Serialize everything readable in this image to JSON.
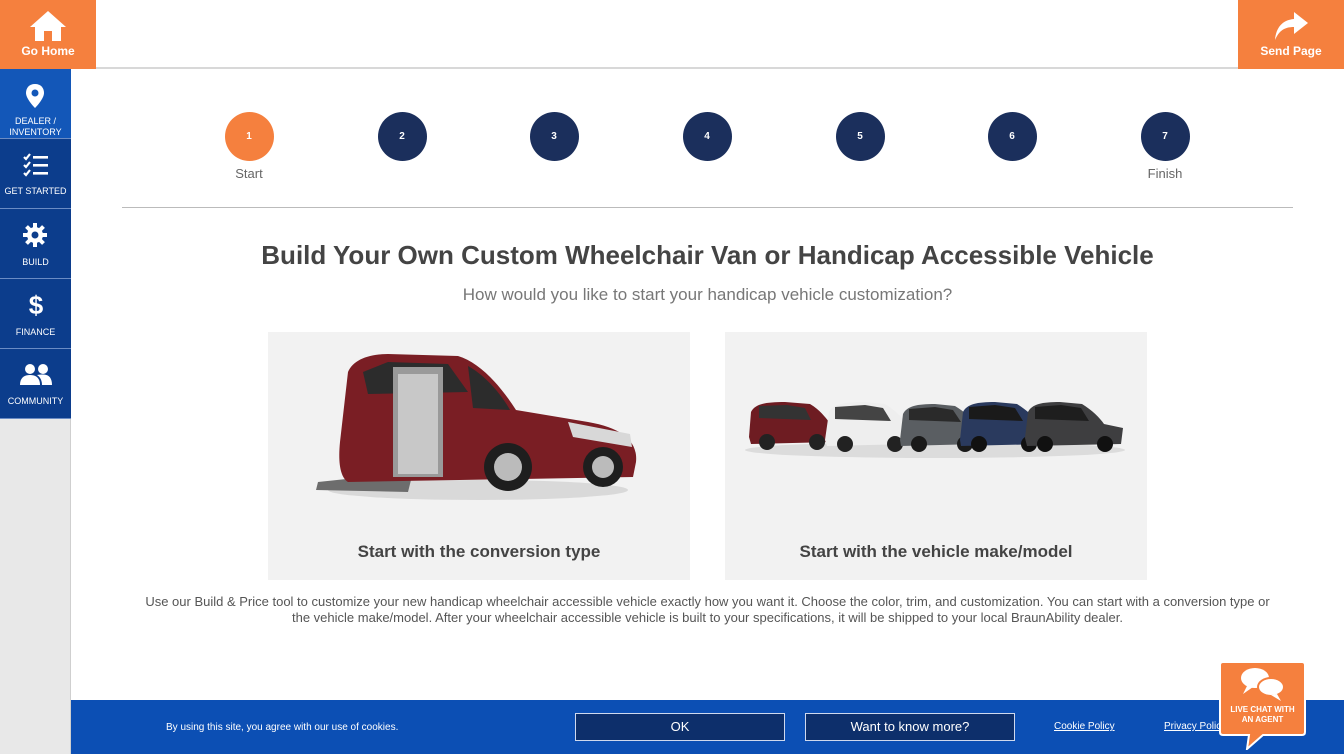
{
  "header": {
    "home_label": "Go Home",
    "send_label": "Send Page"
  },
  "sidebar": {
    "items": [
      {
        "label": "DEALER / INVENTORY",
        "icon": "map-pin-icon"
      },
      {
        "label": "GET STARTED",
        "icon": "checklist-icon"
      },
      {
        "label": "BUILD",
        "icon": "gear-icon"
      },
      {
        "label": "FINANCE",
        "icon": "dollar-icon"
      },
      {
        "label": "COMMUNITY",
        "icon": "users-icon"
      }
    ]
  },
  "steps": [
    {
      "number": "1",
      "label": "Start",
      "active": true
    },
    {
      "number": "2",
      "label": ""
    },
    {
      "number": "3",
      "label": ""
    },
    {
      "number": "4",
      "label": ""
    },
    {
      "number": "5",
      "label": ""
    },
    {
      "number": "6",
      "label": ""
    },
    {
      "number": "7",
      "label": "Finish"
    }
  ],
  "main": {
    "title": "Build Your Own Custom Wheelchair Van or Handicap Accessible Vehicle",
    "subtitle": "How would you like to start your handicap vehicle customization?",
    "cards": [
      {
        "label": "Start with the conversion type"
      },
      {
        "label": "Start with the vehicle make/model"
      }
    ],
    "description": "Use our Build & Price tool to customize your new handicap wheelchair accessible vehicle exactly how you want it. Choose the color, trim, and customization.  You can start with a conversion type or the vehicle make/model.  After your wheelchair accessible vehicle is built to your specifications, it will be shipped to your local BraunAbility dealer."
  },
  "cookie": {
    "text": "By using this site, you agree with our use of cookies.",
    "ok_label": "OK",
    "more_label": "Want to know more?",
    "policy_link": "Cookie Policy",
    "privacy_link": "Privacy Policy"
  },
  "chat": {
    "label_line1": "LIVE CHAT WITH",
    "label_line2": "AN AGENT"
  },
  "colors": {
    "accent": "#f5803e",
    "navy": "#1b2f5c",
    "sidebar_blue": "#0c3d8c",
    "cookie_blue": "#0c4fb4"
  }
}
